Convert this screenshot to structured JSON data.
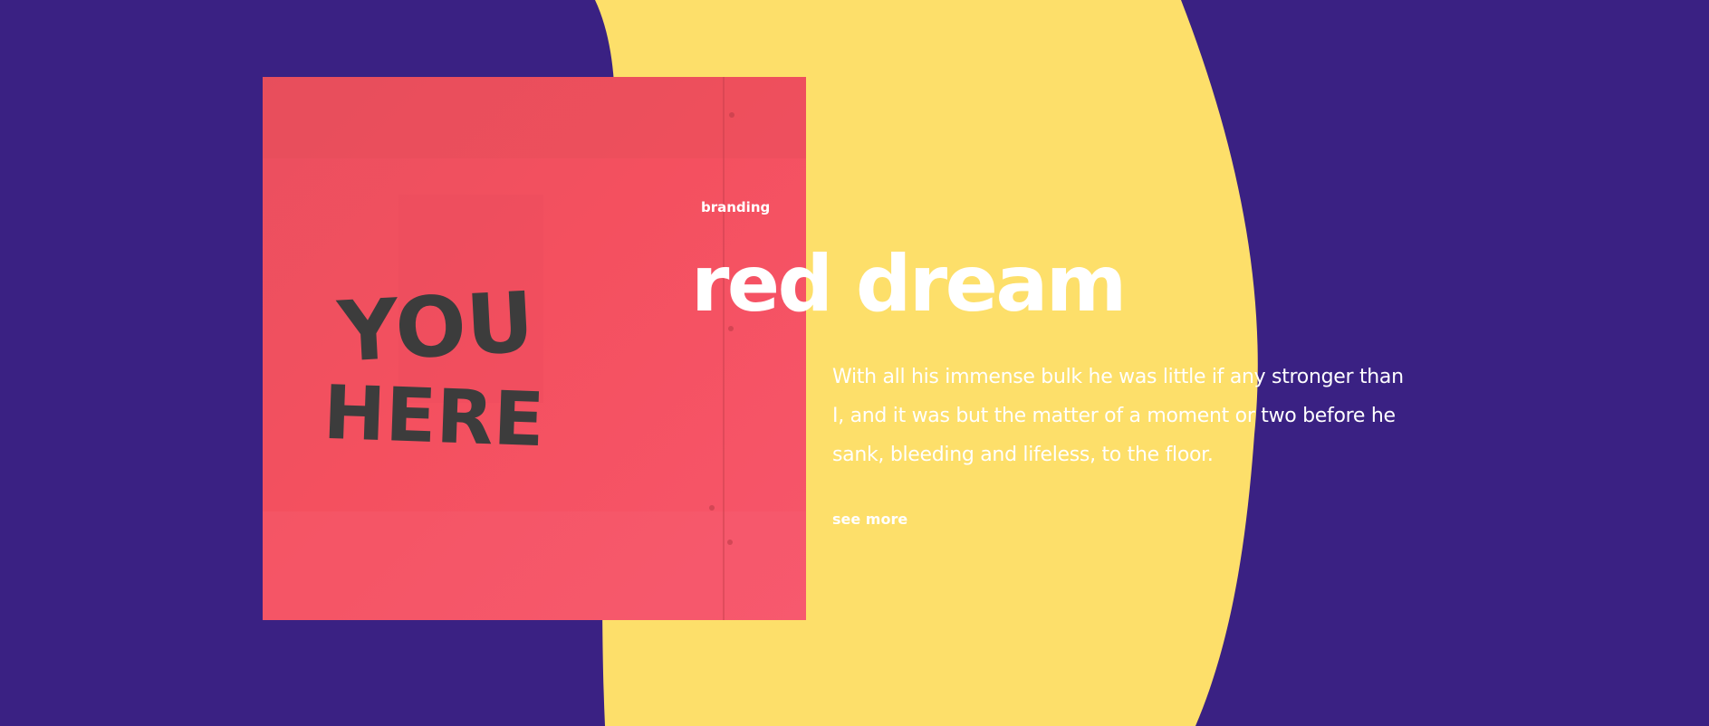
{
  "project": {
    "category": "branding",
    "title": "red dream",
    "description": "With all his immense bulk he was little if any stronger than I, and it was but the matter of a moment or two before he sank, bleeding and lifeless, to the floor.",
    "link_label": "see more"
  },
  "artwork": {
    "painted_text_line1": "YOU",
    "painted_text_line2": "HERE"
  },
  "colors": {
    "background": "#3a2183",
    "blob": "#fddf6a",
    "image_red": "#f55164",
    "paint_text": "#3c3c3c",
    "text": "#ffffff"
  }
}
